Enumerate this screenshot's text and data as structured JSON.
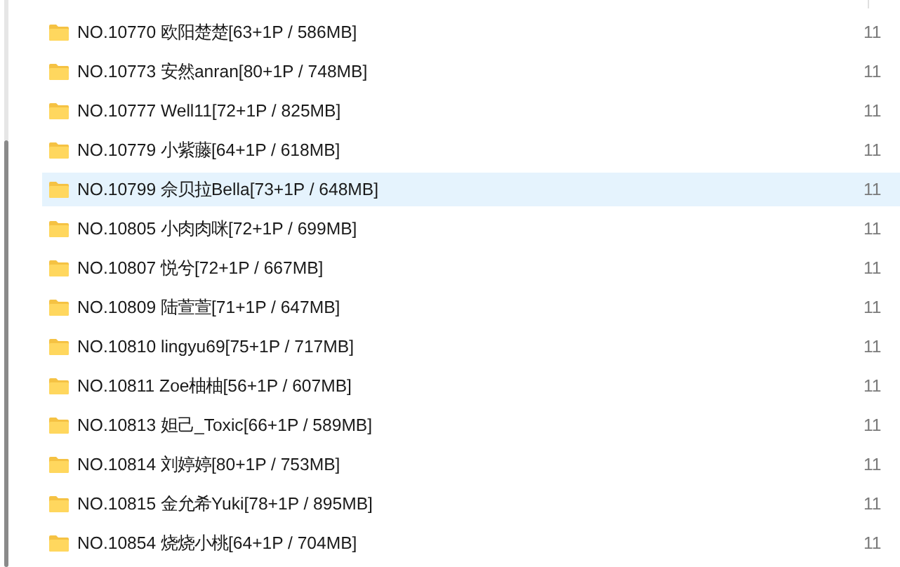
{
  "files": [
    {
      "name": "NO.10770 欧阳楚楚[63+1P / 586MB]",
      "date": "11",
      "selected": false
    },
    {
      "name": "NO.10773 安然anran[80+1P / 748MB]",
      "date": "11",
      "selected": false
    },
    {
      "name": "NO.10777 Well11[72+1P / 825MB]",
      "date": "11",
      "selected": false
    },
    {
      "name": "NO.10779 小紫藤[64+1P / 618MB]",
      "date": "11",
      "selected": false
    },
    {
      "name": "NO.10799 佘贝拉Bella[73+1P / 648MB]",
      "date": "11",
      "selected": true
    },
    {
      "name": "NO.10805 小肉肉咪[72+1P / 699MB]",
      "date": "11",
      "selected": false
    },
    {
      "name": "NO.10807 悦兮[72+1P / 667MB]",
      "date": "11",
      "selected": false
    },
    {
      "name": "NO.10809 陆萱萱[71+1P / 647MB]",
      "date": "11",
      "selected": false
    },
    {
      "name": "NO.10810 lingyu69[75+1P / 717MB]",
      "date": "11",
      "selected": false
    },
    {
      "name": "NO.10811 Zoe柚柚[56+1P / 607MB]",
      "date": "11",
      "selected": false
    },
    {
      "name": "NO.10813 妲己_Toxic[66+1P / 589MB]",
      "date": "11",
      "selected": false
    },
    {
      "name": "NO.10814 刘婷婷[80+1P / 753MB]",
      "date": "11",
      "selected": false
    },
    {
      "name": "NO.10815 金允希Yuki[78+1P / 895MB]",
      "date": "11",
      "selected": false
    },
    {
      "name": "NO.10854 烧烧小桃[64+1P / 704MB]",
      "date": "11",
      "selected": false
    }
  ]
}
